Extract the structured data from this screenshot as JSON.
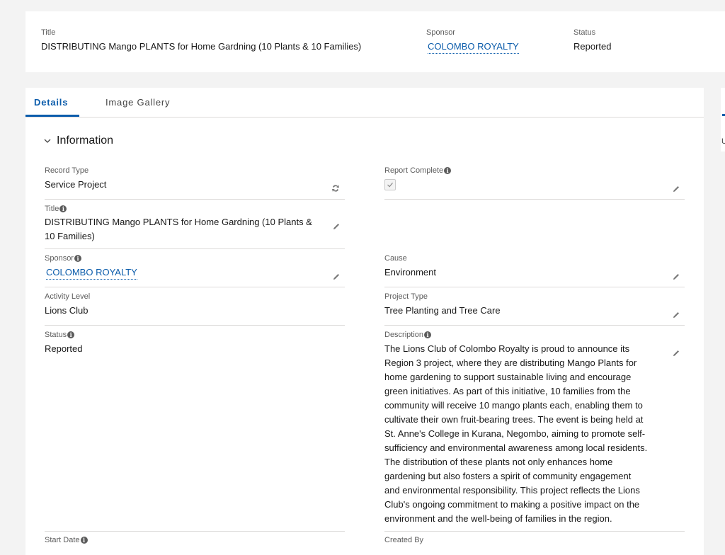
{
  "highlights": {
    "title_label": "Title",
    "title_value": "DISTRIBUTING Mango PLANTS for Home Gardning (10 Plants & 10 Families)",
    "sponsor_label": "Sponsor",
    "sponsor_value": "COLOMBO ROYALTY",
    "status_label": "Status",
    "status_value": "Reported"
  },
  "tabs": [
    {
      "label": "Details",
      "active": true
    },
    {
      "label": "Image Gallery",
      "active": false
    }
  ],
  "section": {
    "title": "Information"
  },
  "fields": {
    "record_type": {
      "label": "Record Type",
      "value": "Service Project"
    },
    "report_complete": {
      "label": "Report Complete",
      "checked": true
    },
    "title": {
      "label": "Title",
      "value_line1": "DISTRIBUTING Mango PLANTS for Home Gardning (10 Plants &",
      "value_line2": "10 Families)"
    },
    "sponsor": {
      "label": "Sponsor",
      "value": "COLOMBO ROYALTY"
    },
    "cause": {
      "label": "Cause",
      "value": "Environment"
    },
    "activity_level": {
      "label": "Activity Level",
      "value": "Lions Club"
    },
    "project_type": {
      "label": "Project Type",
      "value": "Tree Planting and Tree Care"
    },
    "status": {
      "label": "Status",
      "value": "Reported"
    },
    "description": {
      "label": "Description",
      "lines": [
        "The Lions Club of Colombo Royalty is proud to announce its",
        "Region 3 project, where they are distributing Mango Plants for",
        "home gardening to support sustainable living and encourage",
        "green initiatives. As part of this initiative, 10 families from the",
        "community will receive 10 mango plants each, enabling them to",
        "cultivate their own fruit-bearing trees. The event is being held at",
        "St. Anne's College in Kurana, Negombo, aiming to promote self-",
        "sufficiency and environmental awareness among local residents.",
        "The distribution of these plants not only enhances home",
        "gardening but also fosters a spirit of community engagement",
        "and environmental responsibility. This project reflects the Lions",
        "Club's ongoing commitment to making a positive impact on the",
        "environment and the well-being of families in the region."
      ]
    },
    "start_date": {
      "label": "Start Date"
    },
    "created_by": {
      "label": "Created By"
    }
  },
  "icons": {
    "info": "info-icon",
    "edit": "pencil-icon",
    "record_type_change": "change-record-type-icon",
    "collapse": "chevron-down-icon"
  },
  "colors": {
    "link": "#0b5cab",
    "background": "#f3f3f3",
    "divider": "#dddbda"
  },
  "right_panel_fragment": "U"
}
